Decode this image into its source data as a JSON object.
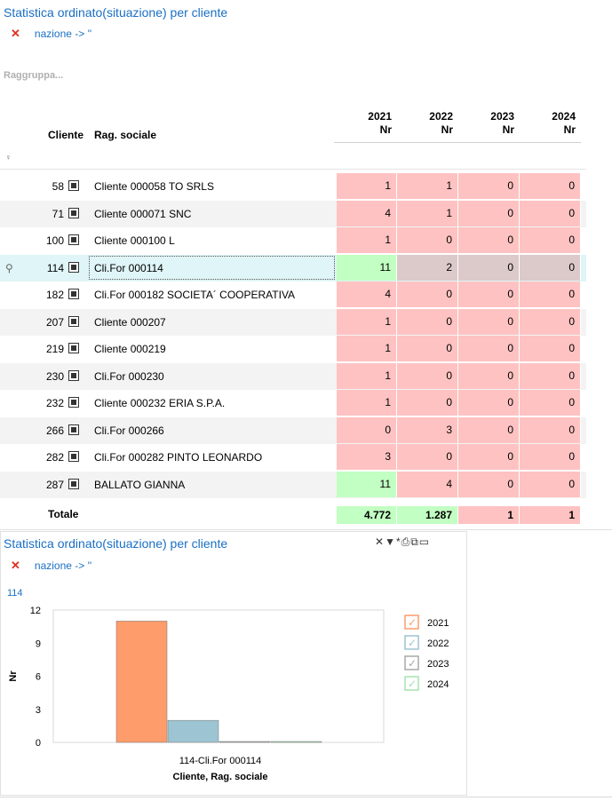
{
  "title": "Statistica ordinato(situazione) per cliente",
  "filter": "nazione -> ''",
  "group_placeholder": "Raggruppa...",
  "headers": {
    "cliente": "Cliente",
    "rag_sociale": "Rag. sociale",
    "years": [
      "2021",
      "2022",
      "2023",
      "2024"
    ],
    "unit": "Nr"
  },
  "rows": [
    {
      "code": "58",
      "name": "Cliente 000058 TO SRLS",
      "values": [
        "1",
        "1",
        "0",
        "0"
      ],
      "colors": [
        "red",
        "red",
        "red",
        "red"
      ]
    },
    {
      "code": "71",
      "name": "Cliente 000071 SNC",
      "values": [
        "4",
        "1",
        "0",
        "0"
      ],
      "colors": [
        "red",
        "red",
        "red",
        "red"
      ]
    },
    {
      "code": "100",
      "name": "Cliente 000100 L",
      "values": [
        "1",
        "0",
        "0",
        "0"
      ],
      "colors": [
        "red",
        "red",
        "red",
        "red"
      ]
    },
    {
      "code": "114",
      "name": "Cli.For 000114",
      "values": [
        "11",
        "2",
        "0",
        "0"
      ],
      "colors": [
        "green",
        "grey",
        "grey",
        "grey"
      ],
      "selected": true
    },
    {
      "code": "182",
      "name": "Cli.For 000182 SOCIETA´ COOPERATIVA",
      "values": [
        "4",
        "0",
        "0",
        "0"
      ],
      "colors": [
        "red",
        "red",
        "red",
        "red"
      ]
    },
    {
      "code": "207",
      "name": "Cliente 000207",
      "values": [
        "1",
        "0",
        "0",
        "0"
      ],
      "colors": [
        "red",
        "red",
        "red",
        "red"
      ]
    },
    {
      "code": "219",
      "name": "Cliente 000219",
      "values": [
        "1",
        "0",
        "0",
        "0"
      ],
      "colors": [
        "red",
        "red",
        "red",
        "red"
      ]
    },
    {
      "code": "230",
      "name": "Cli.For 000230",
      "values": [
        "1",
        "0",
        "0",
        "0"
      ],
      "colors": [
        "red",
        "red",
        "red",
        "red"
      ]
    },
    {
      "code": "232",
      "name": "Cliente 000232 ERIA S.P.A.",
      "values": [
        "1",
        "0",
        "0",
        "0"
      ],
      "colors": [
        "red",
        "red",
        "red",
        "red"
      ]
    },
    {
      "code": "266",
      "name": "Cli.For 000266",
      "values": [
        "0",
        "3",
        "0",
        "0"
      ],
      "colors": [
        "red",
        "red",
        "red",
        "red"
      ]
    },
    {
      "code": "282",
      "name": "Cli.For 000282 PINTO LEONARDO",
      "values": [
        "3",
        "0",
        "0",
        "0"
      ],
      "colors": [
        "red",
        "red",
        "red",
        "red"
      ]
    },
    {
      "code": "287",
      "name": "BALLATO GIANNA",
      "values": [
        "11",
        "4",
        "0",
        "0"
      ],
      "colors": [
        "green",
        "red",
        "red",
        "red"
      ]
    }
  ],
  "totals": {
    "label": "Totale",
    "values": [
      "4.772",
      "1.287",
      "1",
      "1"
    ],
    "colors": [
      "green",
      "green",
      "red",
      "red"
    ]
  },
  "chart_panel": {
    "title": "Statistica ordinato(situazione) per cliente",
    "filter": "nazione -> ''",
    "selected_code": "114",
    "toolbar_icons": [
      "wrench-icon",
      "funnel-icon",
      "print-icon",
      "export-icon",
      "maximize-icon"
    ]
  },
  "colors": {
    "title_blue": "#1a6fc4",
    "cell_red": "#ffc2c2",
    "cell_green": "#c2ffc2",
    "bar_2021": "#ff9c6b",
    "bar_2022": "#9dc4d2",
    "bar_2023": "#a8a8a8",
    "bar_2024": "#a6e3b0"
  },
  "chart_data": {
    "type": "bar",
    "categories": [
      "114-Cli.For 000114"
    ],
    "series": [
      {
        "name": "2021",
        "values": [
          11
        ]
      },
      {
        "name": "2022",
        "values": [
          2
        ]
      },
      {
        "name": "2023",
        "values": [
          0
        ]
      },
      {
        "name": "2024",
        "values": [
          0
        ]
      }
    ],
    "ylabel": "Nr",
    "xlabel": "Cliente, Rag. sociale",
    "ylim": [
      0,
      12
    ],
    "yticks": [
      0,
      3,
      6,
      9,
      12
    ],
    "legend": "right"
  }
}
